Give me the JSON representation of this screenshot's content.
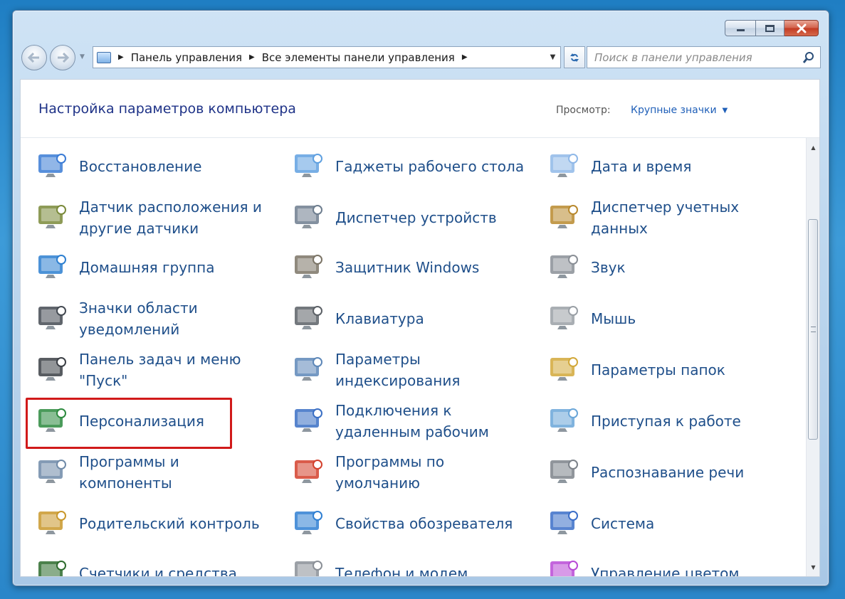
{
  "window": {
    "caption_buttons": [
      "minimize-icon",
      "maximize-icon",
      "close-icon"
    ]
  },
  "navigation": {
    "breadcrumb": [
      "Панель управления",
      "Все элементы панели управления"
    ],
    "search_placeholder": "Поиск в панели управления"
  },
  "header": {
    "title": "Настройка параметров компьютера",
    "view_label": "Просмотр:",
    "view_value": "Крупные значки"
  },
  "items": [
    [
      "Восстановление",
      "Гаджеты рабочего стола",
      "Дата и время"
    ],
    [
      "Датчик расположения и другие датчики",
      "Диспетчер устройств",
      "Диспетчер учетных данных"
    ],
    [
      "Домашняя группа",
      "Защитник Windows",
      "Звук"
    ],
    [
      "Значки области уведомлений",
      "Клавиатура",
      "Мышь"
    ],
    [
      "Панель задач и меню \"Пуск\"",
      "Параметры индексирования",
      "Параметры папок"
    ],
    [
      "Персонализация",
      "Подключения к удаленным рабочим",
      "Приступая к работе"
    ],
    [
      "Программы и компоненты",
      "Программы по умолчанию",
      "Распознавание речи"
    ],
    [
      "Родительский контроль",
      "Свойства обозревателя",
      "Система"
    ],
    [
      "Счетчики и средства",
      "Телефон и модем",
      "Управление цветом"
    ]
  ],
  "item_lines": [
    [
      [
        "Восстановление"
      ],
      [
        "Гаджеты рабочего стола"
      ],
      [
        "Дата и время"
      ]
    ],
    [
      [
        "Датчик расположения и",
        "другие датчики"
      ],
      [
        "Диспетчер устройств"
      ],
      [
        "Диспетчер учетных",
        "данных"
      ]
    ],
    [
      [
        "Домашняя группа"
      ],
      [
        "Защитник Windows"
      ],
      [
        "Звук"
      ]
    ],
    [
      [
        "Значки области",
        "уведомлений"
      ],
      [
        "Клавиатура"
      ],
      [
        "Мышь"
      ]
    ],
    [
      [
        "Панель задач и меню",
        "\"Пуск\""
      ],
      [
        "Параметры",
        "индексирования"
      ],
      [
        "Параметры папок"
      ]
    ],
    [
      [
        "Персонализация"
      ],
      [
        "Подключения к",
        "удаленным рабочим"
      ],
      [
        "Приступая к работе"
      ]
    ],
    [
      [
        "Программы и",
        "компоненты"
      ],
      [
        "Программы по",
        "умолчанию"
      ],
      [
        "Распознавание речи"
      ]
    ],
    [
      [
        "Родительский контроль"
      ],
      [
        "Свойства обозревателя"
      ],
      [
        "Система"
      ]
    ],
    [
      [
        "Счетчики и средства"
      ],
      [
        "Телефон и модем"
      ],
      [
        "Управление цветом"
      ]
    ]
  ],
  "highlighted_item": "Персонализация",
  "colors": {
    "link_text": "#1f4f8a",
    "title_text": "#1e3287",
    "highlight_border": "#d11a1a"
  }
}
